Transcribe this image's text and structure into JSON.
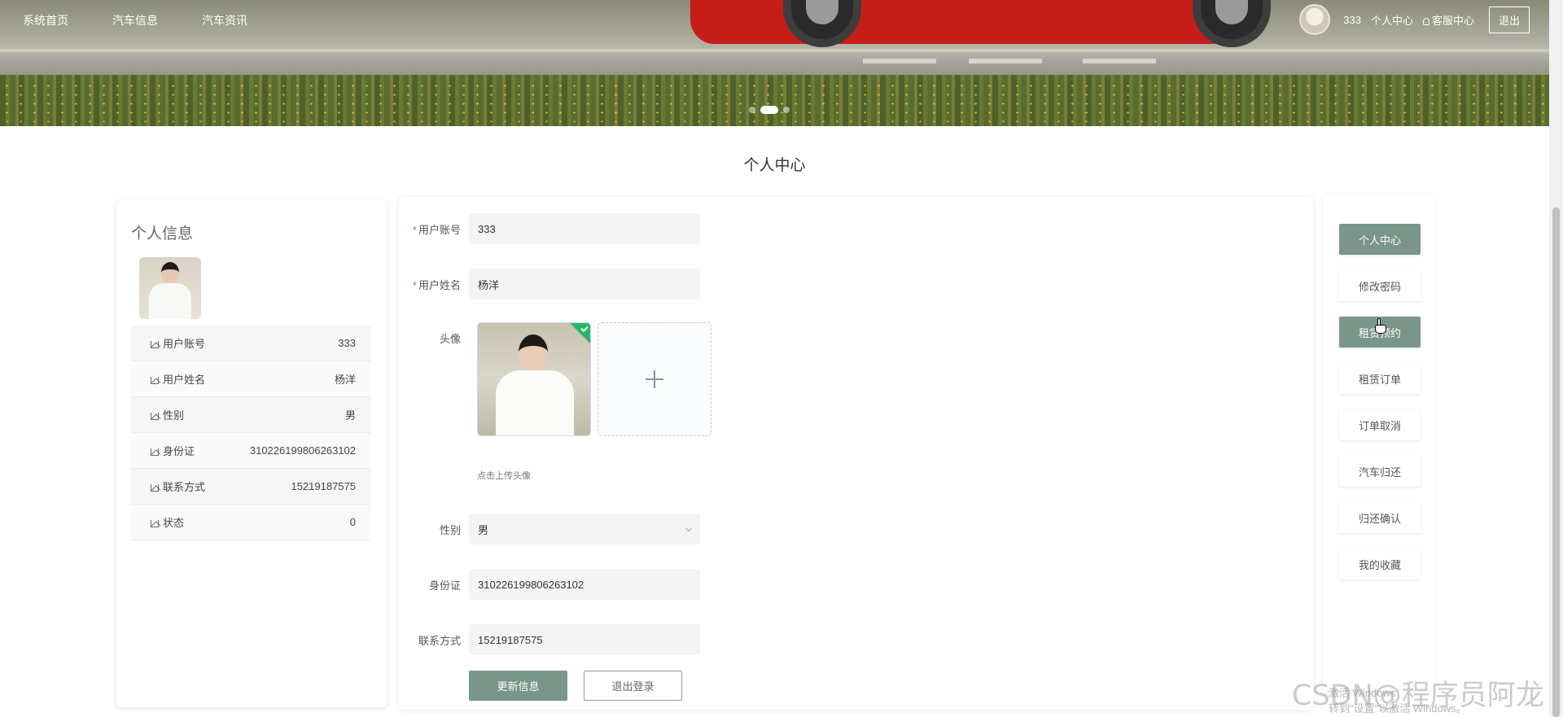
{
  "nav": {
    "items": [
      {
        "label": "系统首页"
      },
      {
        "label": "汽车信息"
      },
      {
        "label": "汽车资讯"
      }
    ],
    "username": "333",
    "personal_center": "个人中心",
    "customer_service": "客服中心",
    "logout": "退出"
  },
  "banner": {
    "slide_count": 3,
    "active_index": 1
  },
  "page_title": "个人中心",
  "profile": {
    "title": "个人信息",
    "rows": [
      {
        "label": "用户账号",
        "value": "333"
      },
      {
        "label": "用户姓名",
        "value": "杨洋"
      },
      {
        "label": "性别",
        "value": "男"
      },
      {
        "label": "身份证",
        "value": "310226199806263102"
      },
      {
        "label": "联系方式",
        "value": "15219187575"
      },
      {
        "label": "状态",
        "value": "0"
      }
    ]
  },
  "form": {
    "account_label": "用户账号",
    "account_value": "333",
    "name_label": "用户姓名",
    "name_value": "杨洋",
    "avatar_label": "头像",
    "upload_tip": "点击上传头像",
    "gender_label": "性别",
    "gender_value": "男",
    "idcard_label": "身份证",
    "idcard_value": "310226199806263102",
    "phone_label": "联系方式",
    "phone_value": "15219187575",
    "update_button": "更新信息",
    "logout_button": "退出登录"
  },
  "menu": {
    "items": [
      {
        "label": "个人中心",
        "active": true
      },
      {
        "label": "修改密码",
        "active": false
      },
      {
        "label": "租赁预约",
        "active": true
      },
      {
        "label": "租赁订单",
        "active": false
      },
      {
        "label": "订单取消",
        "active": false
      },
      {
        "label": "汽车归还",
        "active": false
      },
      {
        "label": "归还确认",
        "active": false
      },
      {
        "label": "我的收藏",
        "active": false
      }
    ]
  },
  "overlay": {
    "watermark": "CSDN@程序员阿龙",
    "activate_line1": "激活 Windows",
    "activate_line2": "转到\"设置\"以激活 Windows。"
  },
  "colors": {
    "accent": "#7a9589",
    "success_badge": "#26b869",
    "required": "#e85a4f"
  }
}
